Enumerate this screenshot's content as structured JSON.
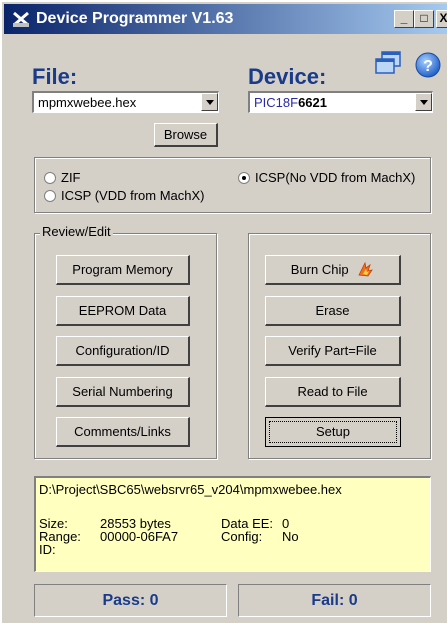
{
  "window": {
    "title": "Device Programmer  V1.63",
    "minimize": "_",
    "maximize": "□",
    "close": "X"
  },
  "file": {
    "heading": "File:",
    "value": "mpmxwebee.hex",
    "browse": "Browse"
  },
  "device": {
    "heading": "Device:",
    "value_prefix": "PIC18F",
    "value_bold": "6621"
  },
  "mode": {
    "zif": "ZIF",
    "icsp_vdd": "ICSP (VDD from MachX)",
    "icsp_novdd": "ICSP(No VDD from MachX)",
    "selected": "icsp_novdd"
  },
  "review": {
    "label": "Review/Edit",
    "buttons": [
      "Program Memory",
      "EEPROM Data",
      "Configuration/ID",
      "Serial Numbering",
      "Comments/Links"
    ]
  },
  "actions": {
    "burn": "Burn Chip",
    "erase": "Erase",
    "verify": "Verify Part=File",
    "read": "Read to File",
    "setup": "Setup"
  },
  "info": {
    "path": "D:\\Project\\SBC65\\websrvr65_v204\\mpmxwebee.hex",
    "size_label": "Size:",
    "size_value": "28553 bytes",
    "range_label": "Range:",
    "range_value": "00000-06FA7",
    "id_label": "ID:",
    "dataee_label": "Data EE:",
    "dataee_value": "0",
    "config_label": "Config:",
    "config_value": "No"
  },
  "status": {
    "pass": "Pass: 0",
    "fail": "Fail: 0"
  },
  "colors": {
    "title_start": "#0a246a",
    "title_end": "#a6caf0",
    "accent_blue": "#1a3b8a",
    "info_bg": "#ffffc0",
    "window_bg": "#d4d0c8"
  }
}
